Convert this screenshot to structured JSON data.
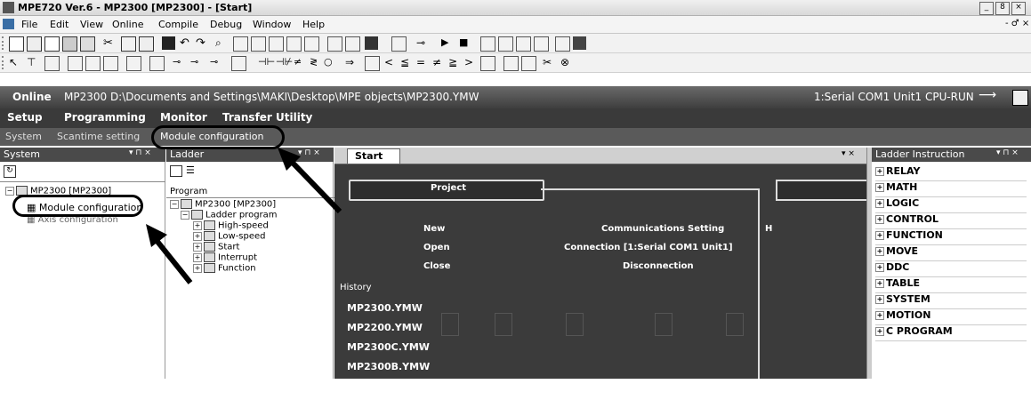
{
  "window": {
    "title": "MPE720 Ver.6 - MP2300 [MP2300] - [Start]",
    "controls": [
      "_",
      "8",
      "×"
    ],
    "mdi_controls": "- ♂ ×"
  },
  "menu": [
    "File",
    "Edit",
    "View",
    "Online",
    "Compile",
    "Debug",
    "Window",
    "Help"
  ],
  "status": {
    "mode": "Online",
    "path": "MP2300 D:\\Documents and Settings\\MAKI\\Desktop\\MPE objects\\MP2300.YMW",
    "connection": "1:Serial COM1 Unit1 CPU-RUN"
  },
  "ribbon_tabs": [
    "Setup",
    "Programming",
    "Monitor",
    "Transfer",
    "Utility"
  ],
  "sub_tabs": [
    "System",
    "Scantime setting",
    "Module configuration"
  ],
  "system_panel": {
    "title": "System",
    "pin": "▾ ⊓ ×",
    "tree_root": "MP2300 [MP2300]",
    "items": [
      "Module configuration",
      "Axis configuration"
    ]
  },
  "ladder_panel": {
    "title": "Ladder",
    "pin": "▾ ⊓ ×",
    "header": "Program",
    "root": "MP2300 [MP2300]",
    "ladder_program": "Ladder program",
    "items": [
      "High-speed",
      "Low-speed",
      "Start",
      "Interrupt",
      "Function"
    ]
  },
  "start_page": {
    "tab": "Start",
    "close": "▾ ×",
    "project_label": "Project",
    "project_items": [
      "New",
      "Open",
      "Close"
    ],
    "comm_items": [
      "Communications Setting",
      "Connection [1:Serial COM1 Unit1]",
      "Disconnection"
    ],
    "history_label": "History",
    "history": [
      "MP2300.YMW",
      "MP2200.YMW",
      "MP2300C.YMW",
      "MP2300B.YMW"
    ],
    "edge_letter": "H"
  },
  "instruction_panel": {
    "title": "Ladder Instruction",
    "pin": "▾ ⊓ ×",
    "items": [
      "RELAY",
      "MATH",
      "LOGIC",
      "CONTROL",
      "FUNCTION",
      "MOVE",
      "DDC",
      "TABLE",
      "SYSTEM",
      "MOTION",
      "C PROGRAM"
    ]
  },
  "icons": [
    "app-icon",
    "new-icon",
    "open-icon",
    "save-icon",
    "cut-icon",
    "copy-icon",
    "paste-icon",
    "undo-icon",
    "redo-icon",
    "find-icon",
    "transfer-icon",
    "connect-arrow-icon"
  ]
}
